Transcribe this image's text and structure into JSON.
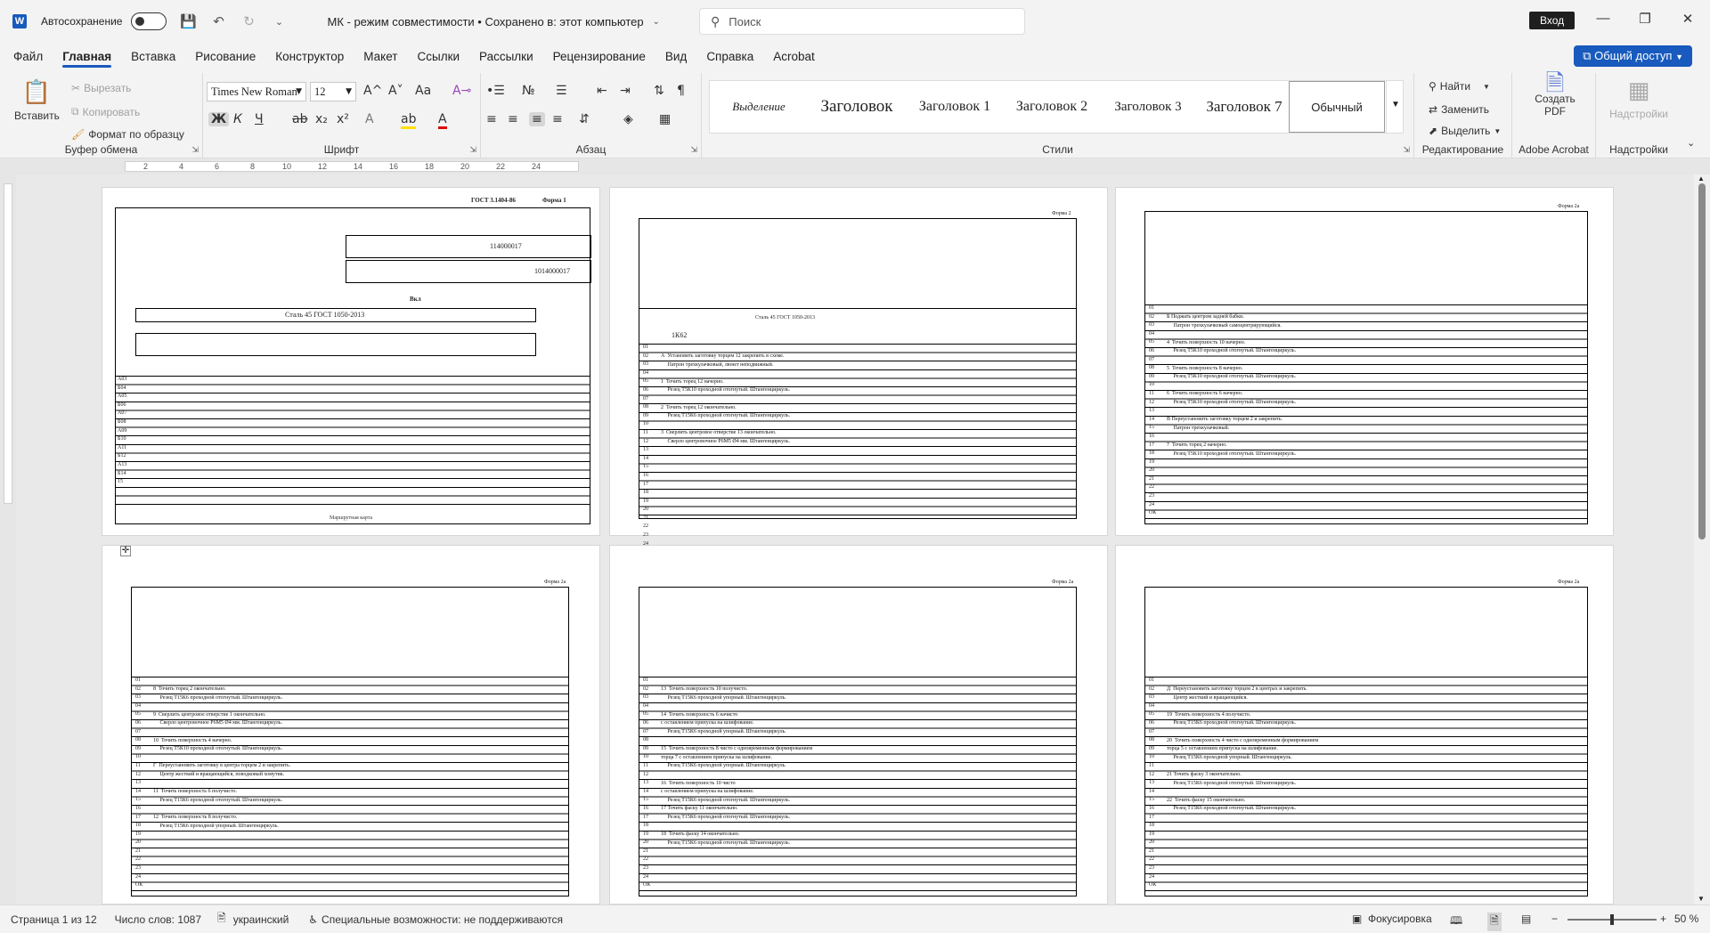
{
  "titlebar": {
    "app_letter": "W",
    "autosave_label": "Автосохранение",
    "doc_title": "МК  -  режим совместимости  •  Сохранено в: этот компьютер",
    "search_placeholder": "Поиск",
    "signin_label": "Вход",
    "icons": [
      "save-icon",
      "undo-icon",
      "redo-icon",
      "customize-icon"
    ]
  },
  "menu": {
    "tabs": [
      "Файл",
      "Главная",
      "Вставка",
      "Рисование",
      "Конструктор",
      "Макет",
      "Ссылки",
      "Рассылки",
      "Рецензирование",
      "Вид",
      "Справка",
      "Acrobat"
    ],
    "active": "Главная",
    "share_label": "Общий доступ"
  },
  "ribbon": {
    "clipboard": {
      "paste": "Вставить",
      "cut": "Вырезать",
      "copy": "Копировать",
      "format_painter": "Формат по образцу",
      "label": "Буфер обмена"
    },
    "font": {
      "name": "Times New Roman",
      "size": "12",
      "label": "Шрифт",
      "bold": "Ж",
      "italic": "К",
      "underline": "Ч",
      "strike": "ab",
      "sub": "x₂",
      "sup": "x²",
      "grow": "A^",
      "shrink": "A˅",
      "case": "Aa",
      "effects": "A",
      "highlight": "ab",
      "color": "A"
    },
    "paragraph": {
      "label": "Абзац"
    },
    "styles": {
      "items": [
        "Выделение",
        "Заголовок",
        "Заголовок 1",
        "Заголовок 2",
        "Заголовок 3",
        "Заголовок 7",
        "Обычный"
      ],
      "selected": "Обычный",
      "label": "Стили"
    },
    "editing": {
      "find": "Найти",
      "replace": "Заменить",
      "select": "Выделить",
      "label": "Редактирование"
    },
    "acrobat": {
      "create_pdf_line1": "Создать",
      "create_pdf_line2": "PDF",
      "label": "Adobe Acrobat"
    },
    "addins": {
      "button": "Надстройки",
      "label": "Надстройки"
    }
  },
  "ruler": {
    "numbers": [
      "2",
      "4",
      "6",
      "8",
      "10",
      "12",
      "14",
      "16",
      "18",
      "20",
      "22",
      "24"
    ]
  },
  "pages": {
    "page1": {
      "gost": "ГОСТ 3.1404-86",
      "form": "Форма 1",
      "code1": "114000017",
      "code2": "1014000017",
      "vkr": "Вкл",
      "material": "Сталь 45 ГОСТ 1050-2013",
      "footer": "Маршрутная карта",
      "rows": [
        "А03",
        "Б04",
        "А05",
        "Б06",
        "А07",
        "Б08",
        "А09",
        "Б10",
        "А11",
        "Б12",
        "А13",
        "Б14",
        "15"
      ]
    },
    "page2": {
      "form": "Форма 2",
      "material": "Сталь 45 ГОСТ 1050-2013",
      "machine": "1К62",
      "ops": [
        "А  Установить заготовку торцем 12 закрепить в схеме.",
        "     Патрон трехкулачковый, люнет неподвижный.",
        "",
        "1  Точить торец 12 начерно.",
        "     Резец Т5К10 проходной отогнутый. Штангенциркуль.",
        "",
        "2  Точить торец 12 окончательно.",
        "     Резец Т15К6 проходной отогнутый. Штангенциркуль.",
        "",
        "3  Сверлить центровое отверстие 13 окончательно.",
        "     Сверло центровочное Р6М5 Ø4 мм. Штангенциркуль."
      ]
    },
    "page3": {
      "form": "Форма 2а",
      "ops": [
        "Б Поджать центром задней бабки.",
        "     Патрон трехкулачковый самоцентрирующийся.",
        "",
        "4  Точить поверхность 10 начерно.",
        "     Резец Т5К10 проходной отогнутый. Штангенциркуль.",
        "",
        "5  Точить поверхность 8 начерно.",
        "     Резец Т5К10 проходной отогнутый. Штангенциркуль.",
        "",
        "6  Точить поверхность 6 начерно.",
        "     Резец Т5К10 проходной отогнутый. Штангенциркуль.",
        "",
        "В Переустановить заготовку торцем 2 и закрепить.",
        "     Патрон трехкулачковый.",
        "",
        "7  Точить торец 2 начерно.",
        "     Резец Т5К10 проходной отогнутый. Штангенциркуль."
      ]
    },
    "page4": {
      "form": "Форма 2а",
      "ops": [
        "8  Точить торец 2 окончательно.",
        "     Резец Т15К6 проходной отогнутый. Штангенциркуль.",
        "",
        "9  Сверлить центровое отверстие 1 окончательно.",
        "     Сверло центровочное Р6М5 Ø4 мм. Штангенциркуль.",
        "",
        "10  Точить поверхность 4 начерно.",
        "     Резец Т5К10 проходной отогнутый. Штангенциркуль.",
        "",
        "Г  Переустановить заготовку в центра торцем 2 и закрепить.",
        "     Центр жесткий и вращающийся, поводковый хомутик.",
        "",
        "11  Точить поверхность 6 получисто.",
        "     Резец Т15К6 проходной отогнутый. Штангенциркуль.",
        "",
        "12  Точить поверхность 8 получисто.",
        "     Резец Т15К6 проходной упорный. Штангенциркуль."
      ]
    },
    "page5": {
      "form": "Форма 2а",
      "ops": [
        "13  Точить поверхность 10 получисто.",
        "     Резец Т15К6 проходной упорный. Штангенциркуль.",
        "",
        "14  Точить поверхность 6 начисто",
        "с оставлением припуска на шлифование.",
        "     Резец Т15К6 проходной упорный. Штангенциркуль.",
        "",
        "15  Точить поверхность 8 чисто с одновременным формированием",
        "торца 7 с оставлением припуска на шлифование.",
        "     Резец Т15К6 проходной упорный. Штангенциркуль.",
        "",
        "16  Точить поверхность 10 чисто",
        "с оставлением припуска на шлифование.",
        "     Резец Т15К6 проходной отогнутый. Штангенциркуль.",
        "17 Точить фаску 11 окончательно.",
        "     Резец Т15К6 проходной отогнутый. Штангенциркуль.",
        "",
        "18  Точить фаску 14 окончательно.",
        "     Резец Т15К6 проходной отогнутый. Штангенциркуль."
      ]
    },
    "page6": {
      "form": "Форма 2а",
      "ops": [
        "Д  Переустановить заготовку торцем 2 в центрах и закрепить.",
        "     Центр жесткий и вращающийся.",
        "",
        "19  Точить поверхность 4 получисто.",
        "     Резец Т15К6 проходной отогнутый. Штангенциркуль.",
        "",
        "20  Точить поверхность 4 чисто с одновременным формированием",
        "торца 5 с оставлением припуска на шлифование.",
        "     Резец Т15К6 проходной упорный. Штангенциркуль.",
        "",
        "21 Точить фаску 3 окончательно.",
        "     Резец Т15К6 проходной отогнутый. Штангенциркуль.",
        "",
        "22  Точить фаску 15 окончательно.",
        "     Резец Т15К6 проходной отогнутый. Штангенциркуль."
      ]
    },
    "row_codes": [
      "01",
      "02",
      "03",
      "04",
      "05",
      "06",
      "07",
      "08",
      "09",
      "10",
      "11",
      "12",
      "13",
      "14",
      "15",
      "16",
      "17",
      "18",
      "19",
      "20",
      "21",
      "22",
      "23",
      "24",
      "ОК"
    ]
  },
  "statusbar": {
    "page": "Страница 1 из 12",
    "words": "Число слов: 1087",
    "language": "украинский",
    "accessibility": "Специальные возможности: не поддерживаются",
    "focus": "Фокусировка",
    "zoom": "50 %"
  }
}
